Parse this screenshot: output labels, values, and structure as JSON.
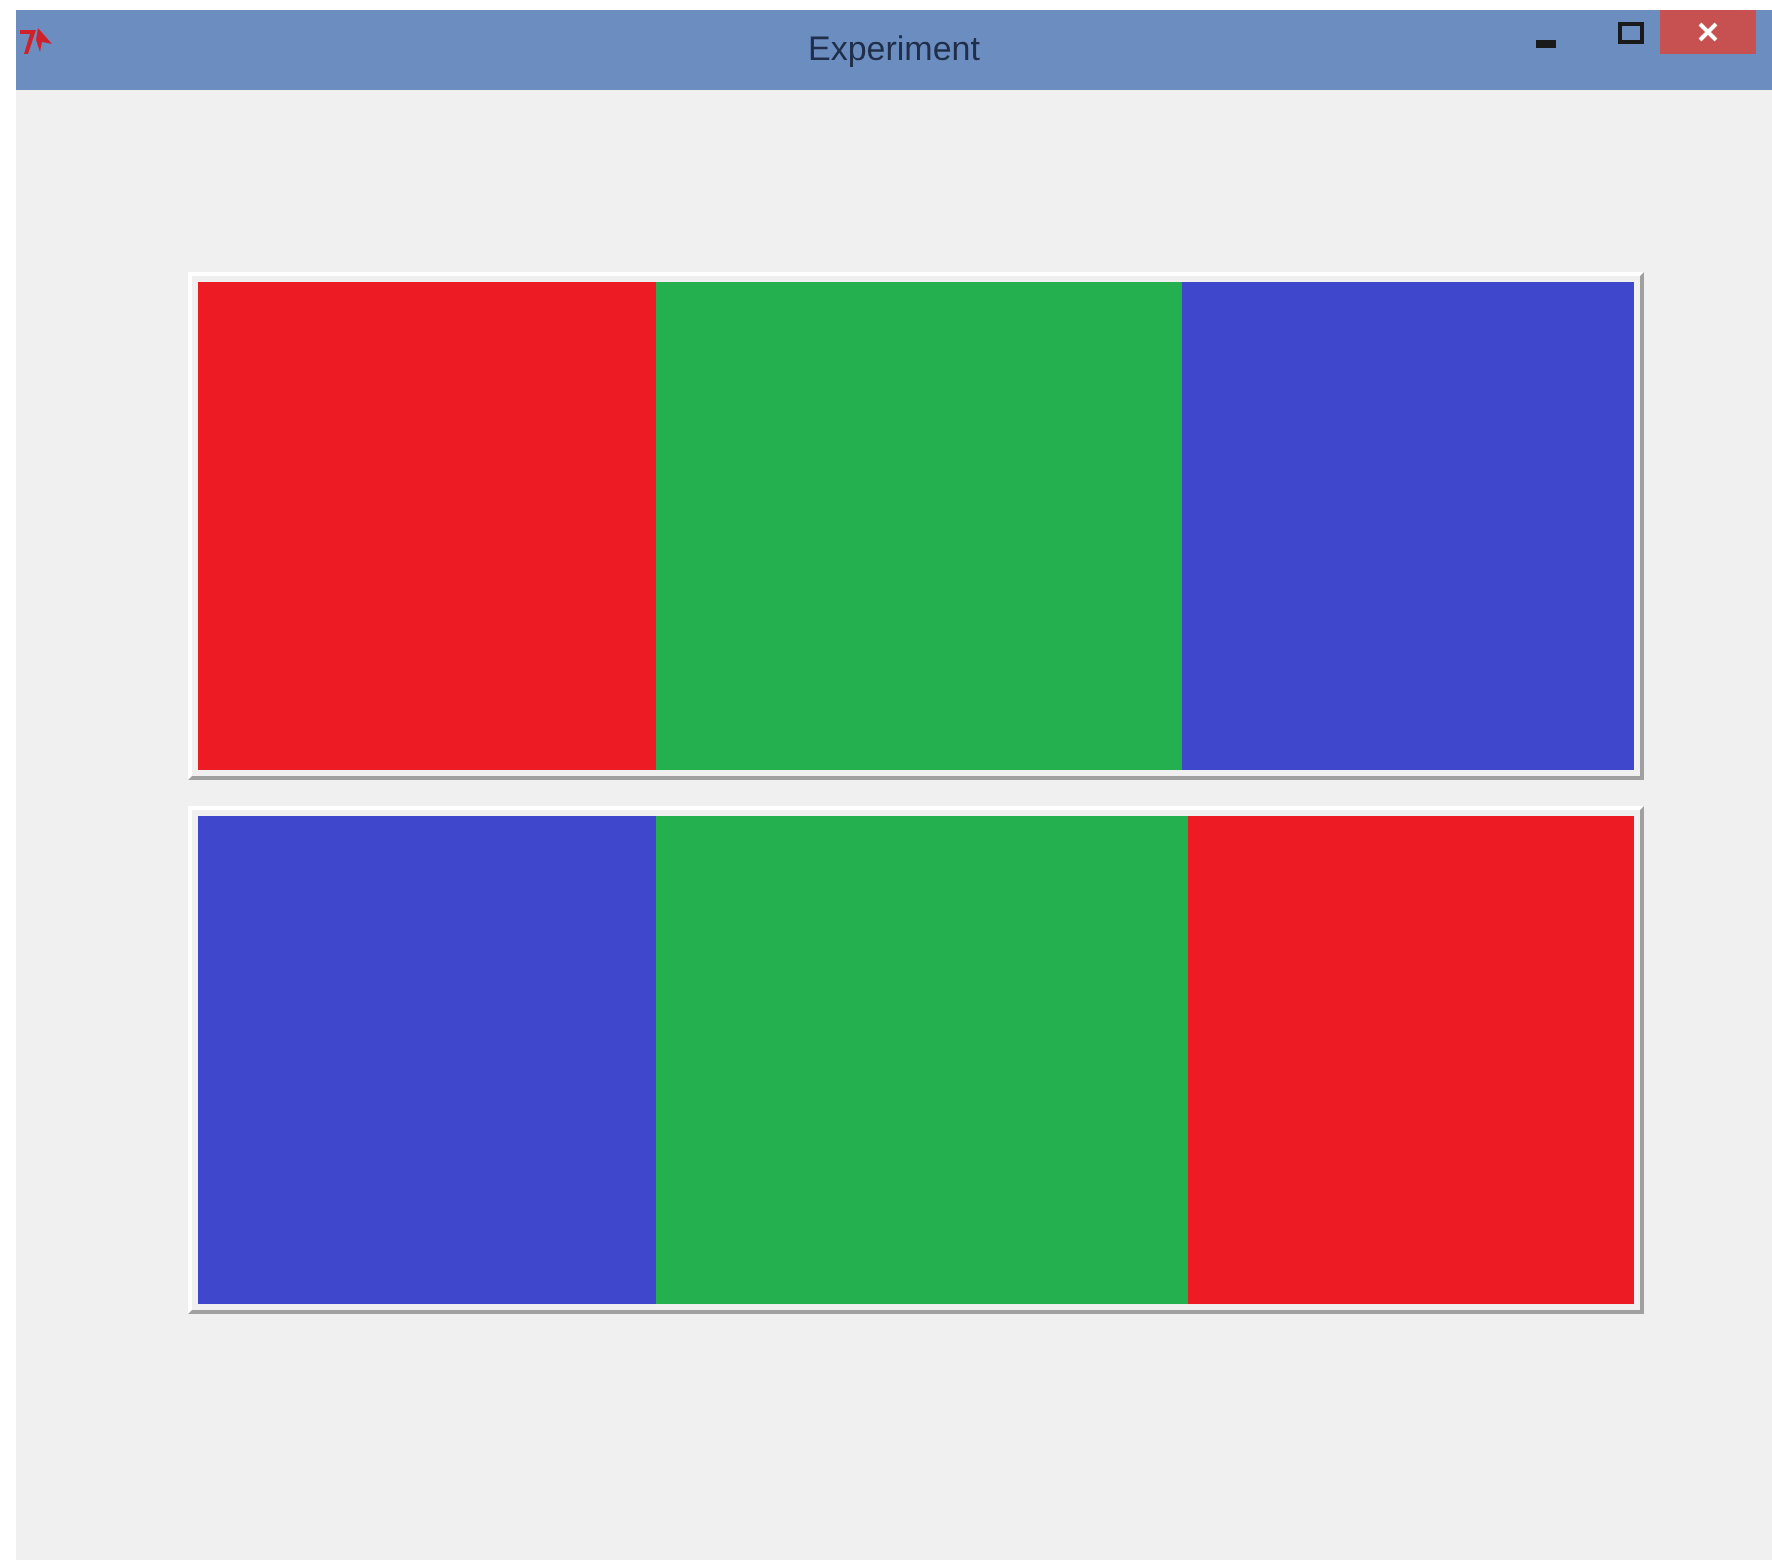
{
  "window": {
    "title": "Experiment"
  },
  "panels": [
    {
      "segments": [
        {
          "color": "#ed1c24"
        },
        {
          "color": "#24b04f"
        },
        {
          "color": "#3f48cc"
        }
      ]
    },
    {
      "segments": [
        {
          "color": "#3f48cc"
        },
        {
          "color": "#24b04f"
        },
        {
          "color": "#ed1c24"
        }
      ]
    }
  ]
}
